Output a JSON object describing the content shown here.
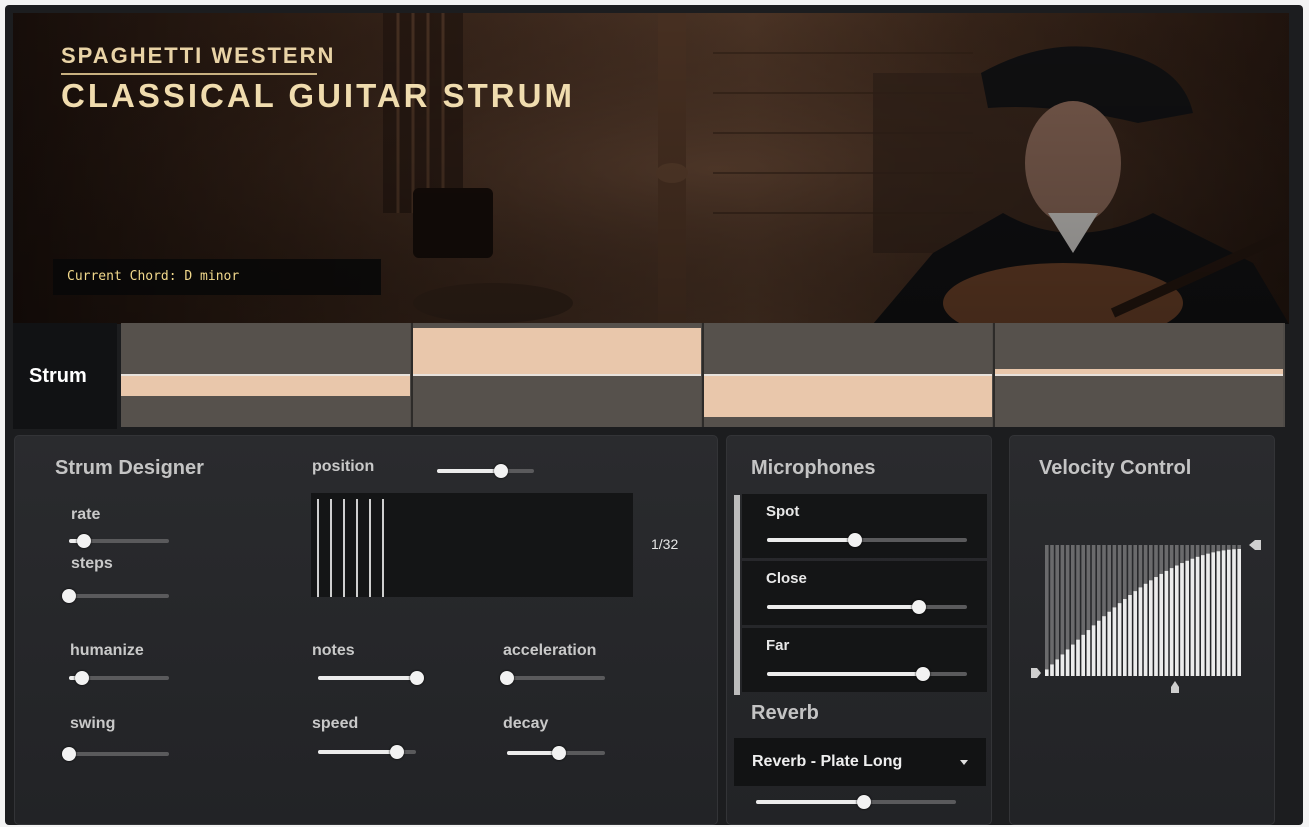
{
  "header": {
    "brand_top": "SPAGHETTI WESTERN",
    "brand_main": "CLASSICAL GUITAR STRUM",
    "current_chord": "Current Chord: D minor"
  },
  "strum": {
    "label": "Strum",
    "steps": [
      {
        "direction": "down",
        "level": 0.4
      },
      {
        "direction": "up",
        "level": 0.9
      },
      {
        "direction": "down",
        "level": 0.8
      },
      {
        "direction": "up",
        "level": 0.12
      }
    ]
  },
  "strum_designer": {
    "title": "Strum Designer",
    "rate": {
      "label": "rate",
      "value": 0.15
    },
    "steps": {
      "label": "steps",
      "value": 0.0
    },
    "position": {
      "label": "position",
      "value": 0.66,
      "display": "1/32",
      "line_count": 6
    },
    "humanize": {
      "label": "humanize",
      "value": 0.13
    },
    "notes": {
      "label": "notes",
      "value": 0.99
    },
    "acceleration": {
      "label": "acceleration",
      "value": 0.0
    },
    "swing": {
      "label": "swing",
      "value": 0.0
    },
    "speed": {
      "label": "speed",
      "value": 0.81
    },
    "decay": {
      "label": "decay",
      "value": 0.53
    }
  },
  "microphones": {
    "title": "Microphones",
    "channels": [
      {
        "label": "Spot",
        "value": 0.44
      },
      {
        "label": "Close",
        "value": 0.76
      },
      {
        "label": "Far",
        "value": 0.78
      }
    ]
  },
  "reverb": {
    "title": "Reverb",
    "preset": "Reverb - Plate Long",
    "amount": 0.54
  },
  "velocity": {
    "title": "Velocity Control",
    "bar_count": 38,
    "curve": "convex-rising",
    "min_level": 0.05,
    "max_level": 0.97
  },
  "colors": {
    "strum_fill": "#e9c7ab",
    "chord_text": "#f2d98c",
    "brand_text": "#f0dcae"
  }
}
